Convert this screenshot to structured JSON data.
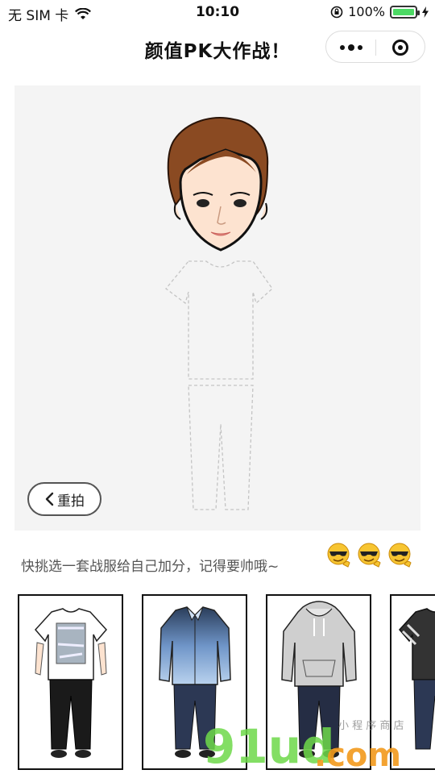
{
  "status_bar": {
    "carrier": "无 SIM 卡",
    "time": "10:10",
    "battery": "100%"
  },
  "nav": {
    "title": "颜值PK大作战！",
    "more_icon": "more-dots-icon",
    "close_icon": "target-close-icon"
  },
  "stage": {
    "retake_label": "重拍"
  },
  "hint": {
    "text": "快挑选一套战服给自己加分，记得要帅哦~"
  },
  "outfits": [
    {
      "name": "white graphic tee",
      "shirt_color": "#ffffff"
    },
    {
      "name": "blue gradient shirt",
      "shirt_color": "#8fb3d9"
    },
    {
      "name": "grey hoodie",
      "shirt_color": "#cfcfcf"
    },
    {
      "name": "striped tee",
      "shirt_color": "#333333"
    }
  ],
  "watermark": {
    "text": "91ud.com",
    "sub": "小 程 序 商 店"
  }
}
